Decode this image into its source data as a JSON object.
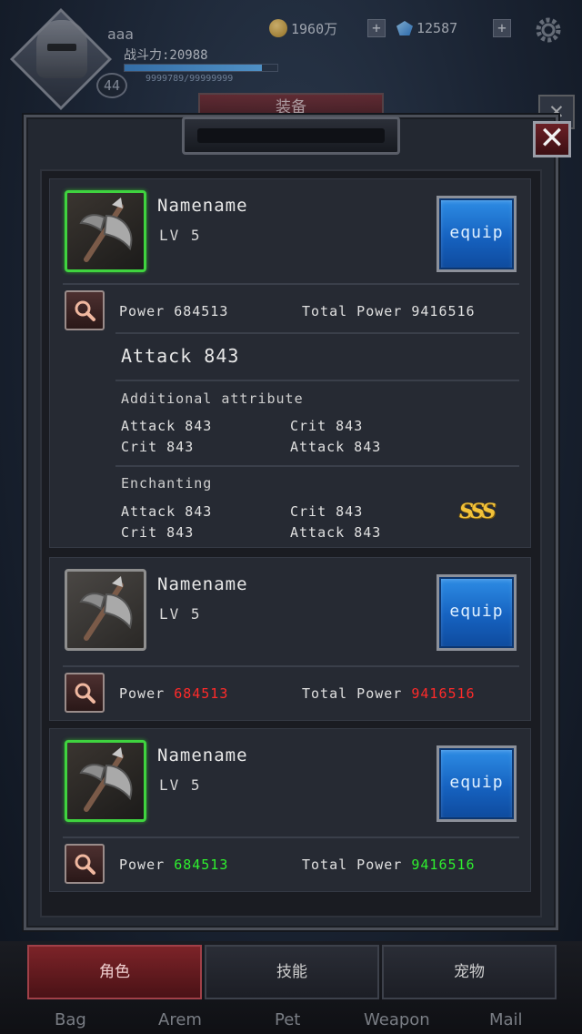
{
  "hud": {
    "player_name": "aaa",
    "combat_power": "战斗力:20988",
    "level": "44",
    "exp_text": "9999789/99999999",
    "exp_fraction": 0.9,
    "gold": "1960万",
    "gems": "12587",
    "plus": "+",
    "window_title": "装备",
    "close_symbol": "✕"
  },
  "items": [
    {
      "name": "Namename",
      "level": "LV 5",
      "equip_label": "equip",
      "power_label": "Power",
      "power_value": "684513",
      "total_power_label": "Total Power",
      "total_power_value": "9416516",
      "attack_main": "Attack 843",
      "additional_label": "Additional attribute",
      "additional": [
        "Attack 843",
        "Crit 843",
        "Crit 843",
        "Attack 843"
      ],
      "enchanting_label": "Enchanting",
      "enchanting": [
        "Attack 843",
        "Crit 843",
        "Crit 843",
        "Attack 843"
      ],
      "grade": "SSS"
    },
    {
      "name": "Namename",
      "level": "LV 5",
      "equip_label": "equip",
      "power_label": "Power",
      "power_value": "684513",
      "total_power_label": "Total Power",
      "total_power_value": "9416516"
    },
    {
      "name": "Namename",
      "level": "LV 5",
      "equip_label": "equip",
      "power_label": "Power",
      "power_value": "684513",
      "total_power_label": "Total Power",
      "total_power_value": "9416516"
    }
  ],
  "nav": {
    "tabs": [
      "角色",
      "技能",
      "宠物"
    ],
    "sub": [
      "Bag",
      "Arem",
      "Pet",
      "Weapon",
      "Mail"
    ]
  },
  "colors": {
    "rarity_green": "#3fd33f",
    "rarity_gray": "#8e8e8e",
    "stat_up": "#2ef02e",
    "stat_down": "#ff2a2a",
    "equip_blue": "#1662c0"
  }
}
